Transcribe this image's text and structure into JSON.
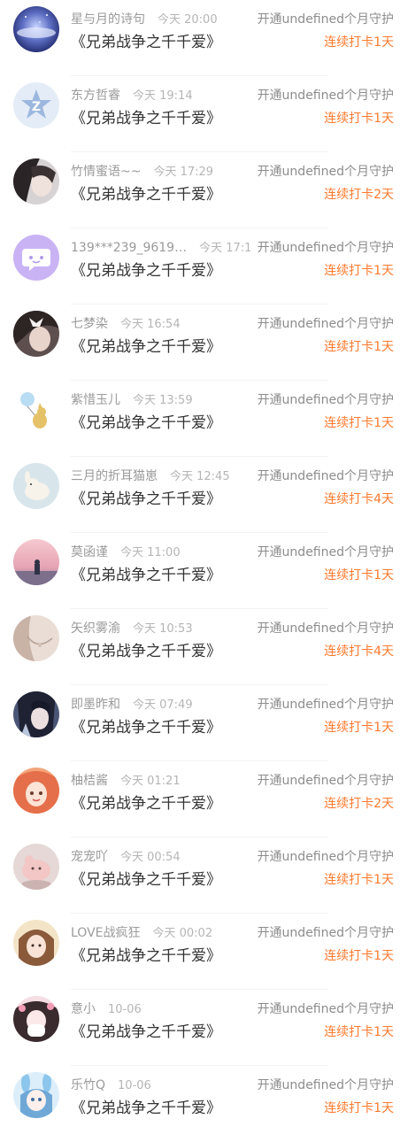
{
  "rows": [
    {
      "name": "星与月的诗句",
      "time": "今天 20:00",
      "title": "《兄弟战争之千千爱》",
      "action": "开通undefined个月守护",
      "streak": "连续打卡1天",
      "avatar": "starry-night"
    },
    {
      "name": "东方哲睿",
      "time": "今天 19:14",
      "title": "《兄弟战争之千千爱》",
      "action": "开通undefined个月守护",
      "streak": "连续打卡1天",
      "avatar": "default-star-z"
    },
    {
      "name": "竹情蜜语~~",
      "time": "今天 17:29",
      "title": "《兄弟战争之千千爱》",
      "action": "开通undefined个月守护",
      "streak": "连续打卡2天",
      "avatar": "girl-portrait"
    },
    {
      "name": "139***239_9619…",
      "time": "今天 17:1",
      "title": "《兄弟战争之千千爱》",
      "action": "开通undefined个月守护",
      "streak": "连续打卡1天",
      "avatar": "default-chat-bubble"
    },
    {
      "name": "七梦染",
      "time": "今天 16:54",
      "title": "《兄弟战争之千千爱》",
      "action": "开通undefined个月守护",
      "streak": "连续打卡1天",
      "avatar": "girl-bow"
    },
    {
      "name": "紫惜玉儿",
      "time": "今天 13:59",
      "title": "《兄弟战争之千千爱》",
      "action": "开通undefined个月守护",
      "streak": "连续打卡1天",
      "avatar": "cat-balloon"
    },
    {
      "name": "三月的折耳猫崽",
      "time": "今天 12:45",
      "title": "《兄弟战争之千千爱》",
      "action": "开通undefined个月守护",
      "streak": "连续打卡4天",
      "avatar": "plush-bunny"
    },
    {
      "name": "莫函谨",
      "time": "今天 11:00",
      "title": "《兄弟战争之千千爱》",
      "action": "开通undefined个月守护",
      "streak": "连续打卡1天",
      "avatar": "sunset-girl"
    },
    {
      "name": "矢织雾渝",
      "time": "今天 10:53",
      "title": "《兄弟战争之千千爱》",
      "action": "开通undefined个月守护",
      "streak": "连续打卡4天",
      "avatar": "necklace"
    },
    {
      "name": "即墨昨和",
      "time": "今天 07:49",
      "title": "《兄弟战争之千千爱》",
      "action": "开通undefined个月守护",
      "streak": "连续打卡1天",
      "avatar": "anime-dark-hair"
    },
    {
      "name": "柚桔酱",
      "time": "今天 01:21",
      "title": "《兄弟战争之千千爱》",
      "action": "开通undefined个月守护",
      "streak": "连续打卡2天",
      "avatar": "anime-orange-hair"
    },
    {
      "name": "宠宠吖",
      "time": "今天 00:54",
      "title": "《兄弟战争之千千爱》",
      "action": "开通undefined个月守护",
      "streak": "连续打卡1天",
      "avatar": "pink-pet"
    },
    {
      "name": "LOVE战疯狂",
      "time": "今天 00:02",
      "title": "《兄弟战争之千千爱》",
      "action": "开通undefined个月守护",
      "streak": "连续打卡1天",
      "avatar": "girl-brown-hair"
    },
    {
      "name": "意小",
      "time": "10-06",
      "title": "《兄弟战争之千千爱》",
      "action": "开通undefined个月守护",
      "streak": "连续打卡1天",
      "avatar": "girl-pink-flowers"
    },
    {
      "name": "乐竹Q",
      "time": "10-06",
      "title": "《兄弟战争之千千爱》",
      "action": "开通undefined个月守护",
      "streak": "连续打卡1天",
      "avatar": "anime-blue-bunny"
    }
  ]
}
